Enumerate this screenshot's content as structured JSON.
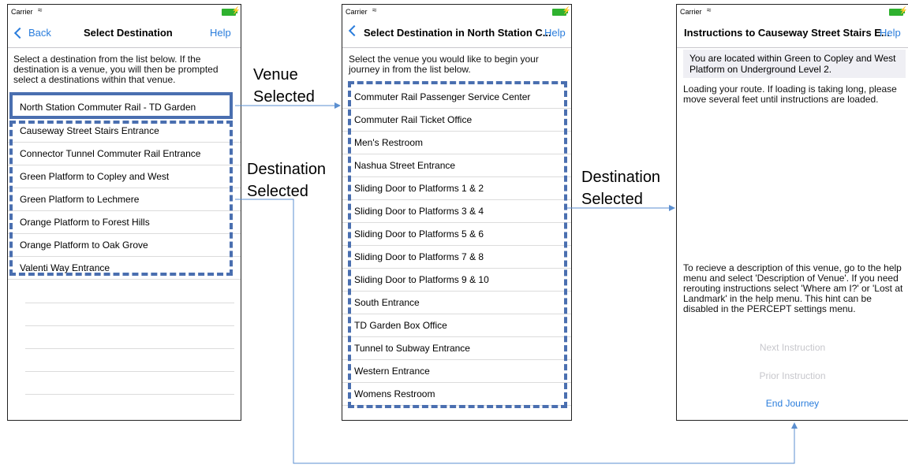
{
  "status": {
    "carrier": "Carrier",
    "bolt": "⚡"
  },
  "screen1": {
    "back_label": "Back",
    "title": "Select Destination",
    "help": "Help",
    "instructions": "Select a destination from the list below.  If the destination is a venue, you will then be prompted select a destinations within that venue.",
    "venue_row": "North Station Commuter Rail - TD Garden",
    "items": [
      "Causeway Street Stairs Entrance",
      "Connector Tunnel Commuter Rail Entrance",
      "Green Platform to Copley and West",
      "Green Platform to Lechmere",
      "Orange Platform to Forest Hills",
      "Orange Platform to Oak Grove",
      "Valenti Way Entrance"
    ]
  },
  "screen2": {
    "title": "Select Destination in North Station C...",
    "help": "Help",
    "instructions": "Select the venue you would like to begin your journey in from the list below.",
    "items": [
      "Commuter Rail Passenger Service Center",
      "Commuter Rail Ticket Office",
      "Men's Restroom",
      "Nashua Street Entrance",
      "Sliding Door to Platforms 1 & 2",
      "Sliding Door to Platforms 3 & 4",
      "Sliding Door to Platforms 5 & 6",
      "Sliding Door to Platforms 7 & 8",
      "Sliding Door to Platforms 9 & 10",
      "South Entrance",
      "TD Garden Box Office",
      "Tunnel to Subway Entrance",
      "Western Entrance",
      "Womens Restroom"
    ]
  },
  "screen3": {
    "title": "Instructions to Causeway Street Stairs E...",
    "help": "Help",
    "location": "You are located within Green to Copley and West Platform  on Underground Level 2.",
    "loading": "Loading your route.  If loading is taking long, please move several feet until instructions are loaded.",
    "hint": "To recieve a description of this venue, go to the help menu and select 'Description of Venue'. If you need rerouting instructions select 'Where am I?' or 'Lost at Landmark' in the help menu. This hint can be disabled in the PERCEPT settings menu.",
    "next": "Next Instruction",
    "prior": "Prior Instruction",
    "end": "End Journey"
  },
  "annotations": {
    "venue_line1": "Venue",
    "venue_line2": "Selected",
    "dest1_line1": "Destination",
    "dest1_line2": "Selected",
    "dest2_line1": "Destination",
    "dest2_line2": "Selected"
  },
  "colors": {
    "accent": "#2a7ddc",
    "highlight": "#4a6fb0",
    "arrow": "#5b8fd0"
  }
}
